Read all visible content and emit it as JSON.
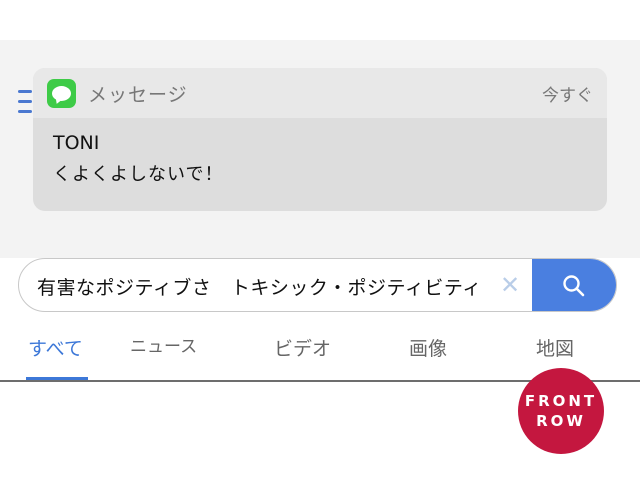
{
  "notification": {
    "app_name": "メッセージ",
    "time": "今すぐ",
    "sender": "TONI",
    "message": "くよくよしないで！"
  },
  "search": {
    "query": "有害なポジティブさ　トキシック・ポジティビティ"
  },
  "tabs": [
    {
      "label": "すべて",
      "active": true
    },
    {
      "label": "ニュース",
      "active": false
    },
    {
      "label": "ビデオ",
      "active": false
    },
    {
      "label": "画像",
      "active": false
    },
    {
      "label": "地図",
      "active": false
    }
  ],
  "logo": {
    "line1": "FRONT",
    "line2": "ROW"
  },
  "colors": {
    "accent": "#3d78d8",
    "search_button": "#4a7fe0",
    "messages_green": "#3ecb47",
    "logo_red": "#c4173f"
  }
}
